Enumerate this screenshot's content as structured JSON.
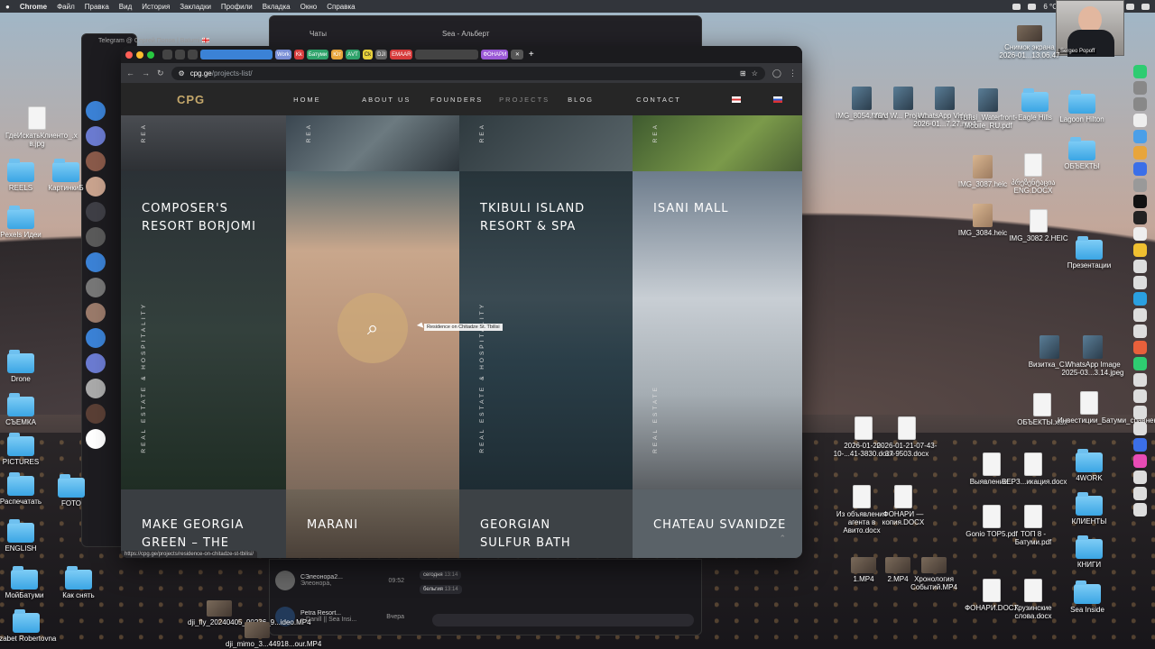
{
  "menubar": {
    "app": "Chrome",
    "items": [
      "Файл",
      "Правка",
      "Вид",
      "История",
      "Закладки",
      "Профили",
      "Вкладка",
      "Окно",
      "Справка"
    ],
    "temp": "6 °C"
  },
  "webcam": {
    "name": "Sergeo Popoff"
  },
  "telegram": {
    "title": "Telegram @ Сергей Попов | Batumi 🇬🇪",
    "tab_chats": "Чаты",
    "chat_header": "Sea - Альберт",
    "rows": [
      {
        "name": "СЭлеонора2...",
        "time": "09:52",
        "sub": "Элеонора,"
      },
      {
        "name": "Petra Resort...",
        "time": "Вчера",
        "sub": "~ Danill || Sea Insi..."
      }
    ],
    "messages": [
      {
        "text": "сегодня",
        "time": "13:14"
      },
      {
        "text": "бельгия",
        "time": "13:14"
      }
    ]
  },
  "chrome": {
    "tabs": [
      "Work",
      "Kk",
      "Батуми",
      "Ют",
      "АVT",
      "Ck",
      "DJI",
      "EMAAR",
      "ФОНАРИ"
    ],
    "url_host": "cpg.ge",
    "url_path": "/projects-list/",
    "status_url": "https://cpg.ge/projects/residence-on-chitadze-st-tbilisi/"
  },
  "site": {
    "logo": "CPG",
    "nav": [
      "HOME",
      "ABOUT US",
      "FOUNDERS",
      "PROJECTS",
      "BLOG",
      "CONTACT"
    ],
    "active_nav": "PROJECTS",
    "tooltip": "Residence on Chitadze St. Tbilisi",
    "tiles_top": [
      {
        "label": "REA"
      },
      {
        "label": "REA"
      },
      {
        "label": "REA"
      },
      {
        "label": "REA"
      }
    ],
    "tiles_mid": [
      {
        "name": "COMPOSER'S RESORT BORJOMI",
        "cat": "REAL ESTATE & HOSPITALITY"
      },
      {
        "name": "",
        "cat": ""
      },
      {
        "name": "TKIBULI ISLAND RESORT & SPA",
        "cat": "REAL ESTATE & HOSPITALITY"
      },
      {
        "name": "ISANI MALL",
        "cat": "REAL ESTATE"
      }
    ],
    "tiles_bottom": [
      {
        "name": "MAKE GEORGIA GREEN – THE"
      },
      {
        "name": "MARANI"
      },
      {
        "name": "GEORGIAN SULFUR BATH"
      },
      {
        "name": "CHATEAU SVANIDZE"
      }
    ]
  },
  "desktop": {
    "left": [
      {
        "label": "ГдеИскатьКлиенто_.x в.jpg",
        "kind": "doc"
      },
      {
        "label": "REELS",
        "kind": "folder"
      },
      {
        "label": "КартинкиБ",
        "kind": "folder"
      },
      {
        "label": "Pexels Идеи",
        "kind": "folder"
      },
      {
        "label": "Drone",
        "kind": "folder"
      },
      {
        "label": "СЪЕМКА",
        "kind": "folder"
      },
      {
        "label": "PICTURES",
        "kind": "folder"
      },
      {
        "label": "Распечатать",
        "kind": "folder"
      },
      {
        "label": "FOTO",
        "kind": "folder"
      },
      {
        "label": "ENGLISH",
        "kind": "folder"
      },
      {
        "label": "МойБатуми",
        "kind": "folder"
      },
      {
        "label": "Как снять",
        "kind": "folder"
      },
      {
        "label": "lizabet Robertovna",
        "kind": "folder"
      },
      {
        "label": "dji_fly_20240405_90236_9...ideo.MP4",
        "kind": "film"
      },
      {
        "label": "dji_mimo_3...44918...our.MP4",
        "kind": "film"
      }
    ],
    "right": [
      {
        "label": "Снимок экрана 2026-01...13.06.47",
        "kind": "film"
      },
      {
        "label": "IMG_8054.MOV",
        "kind": "thumb"
      },
      {
        "label": "Yard W... Project...",
        "kind": "thumb"
      },
      {
        "label": "WhatsApp Video 2026-01...7.27.mp4",
        "kind": "thumb"
      },
      {
        "label": "Tbilisi_Waterfront-Mobile_RU.pdf",
        "kind": "thumb"
      },
      {
        "label": "Eagle Hills",
        "kind": "folder"
      },
      {
        "label": "Lagoon Hilton",
        "kind": "folder"
      },
      {
        "label": "ОБЪЕКТЫ",
        "kind": "folder"
      },
      {
        "label": "IMG_3087.heic",
        "kind": "tan"
      },
      {
        "label": "პრეზენტაცია ENG.DOCX",
        "kind": "doc"
      },
      {
        "label": "IMG_3084.heic",
        "kind": "tan"
      },
      {
        "label": "IMG_3082 2.HEIC",
        "kind": "doc"
      },
      {
        "label": "Презентации",
        "kind": "folder"
      },
      {
        "label": "Визитка_C...",
        "kind": "thumb"
      },
      {
        "label": "WhatsApp Image 2025-03...3.14.jpeg",
        "kind": "thumb"
      },
      {
        "label": "ОБЪЕКТЫ.xlsx",
        "kind": "doc"
      },
      {
        "label": "Инвестиции_Батуми_сравнение.pdf",
        "kind": "doc"
      },
      {
        "label": "2026-01-20-10-...41-3830.docx",
        "kind": "doc"
      },
      {
        "label": "2026-01-21-07-43-37-9503.docx",
        "kind": "doc"
      },
      {
        "label": "Выявление...",
        "kind": "doc"
      },
      {
        "label": "ВЕРЗ...икация.docx",
        "kind": "doc"
      },
      {
        "label": "4WORK",
        "kind": "folder"
      },
      {
        "label": "Из объявления агента в Авито.docx",
        "kind": "doc"
      },
      {
        "label": "ФОНАРИ — копия.DOCX",
        "kind": "doc"
      },
      {
        "label": "Gonio TOP5.pdf",
        "kind": "doc"
      },
      {
        "label": "ТОП 8 - Батуми.pdf",
        "kind": "doc"
      },
      {
        "label": "КЛИЕНТЫ",
        "kind": "folder"
      },
      {
        "label": "КНИГИ",
        "kind": "folder"
      },
      {
        "label": "1.MP4",
        "kind": "film"
      },
      {
        "label": "2.MP4",
        "kind": "film"
      },
      {
        "label": "Хронология Событий.MP4",
        "kind": "film"
      },
      {
        "label": "ФОНАРИ.DOCX",
        "kind": "doc"
      },
      {
        "label": "Грузинские слова.docx",
        "kind": "doc"
      },
      {
        "label": "Sea Inside",
        "kind": "folder"
      }
    ]
  }
}
